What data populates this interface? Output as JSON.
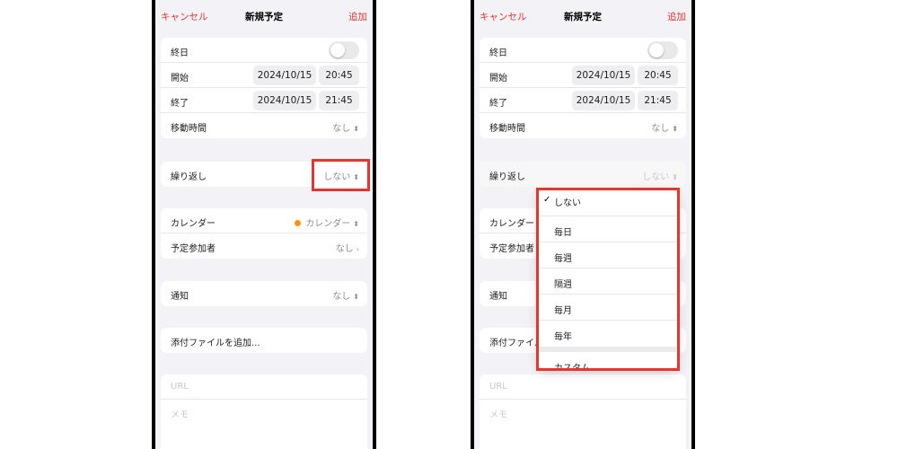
{
  "nav": {
    "cancel": "キャンセル",
    "title": "新規予定",
    "add": "追加"
  },
  "form": {
    "all_day": "終日",
    "start": {
      "label": "開始",
      "date": "2024/10/15",
      "time": "20:45"
    },
    "end": {
      "label": "終了",
      "date": "2024/10/15",
      "time": "21:45"
    },
    "travel_time": {
      "label": "移動時間",
      "value": "なし"
    },
    "repeat": {
      "label": "繰り返し",
      "value": "しない"
    },
    "calendar": {
      "label": "カレンダー",
      "value": "カレンダー"
    },
    "invitees": {
      "label": "予定参加者",
      "value": "なし"
    },
    "alert": {
      "label": "通知",
      "value": "なし"
    },
    "attachment": {
      "label": "添付ファイルを追加..."
    },
    "url": {
      "placeholder": "URL"
    },
    "notes": {
      "placeholder": "メモ"
    }
  },
  "repeat_menu": {
    "selected": "しない",
    "options": [
      "しない",
      "毎日",
      "毎週",
      "隔週",
      "毎月",
      "毎年"
    ],
    "custom": "カスタム"
  },
  "colors": {
    "accent": "#e5352d",
    "calendar_dot": "#ff9500",
    "highlight": "#e5352d"
  }
}
